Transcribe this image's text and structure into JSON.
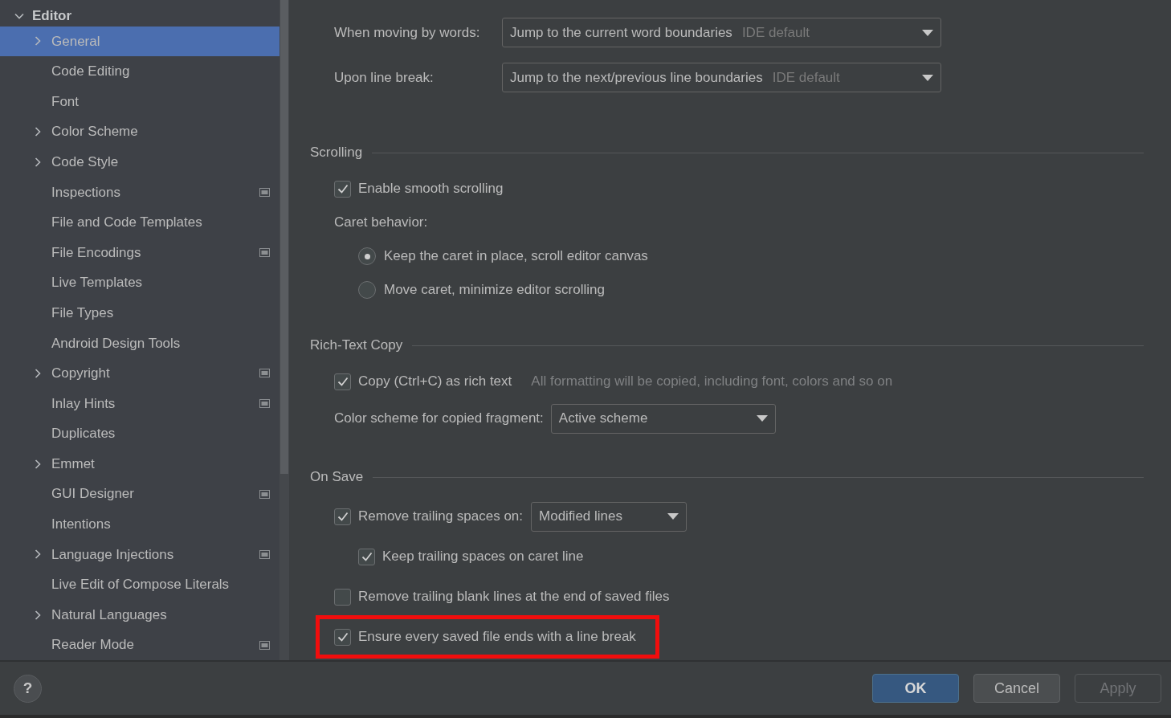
{
  "sidebar": {
    "header": {
      "label": "Editor",
      "expanded": true
    },
    "items": [
      {
        "label": "General",
        "expandable": true,
        "selected": true,
        "project_icon": false
      },
      {
        "label": "Code Editing",
        "expandable": false,
        "selected": false,
        "project_icon": false
      },
      {
        "label": "Font",
        "expandable": false,
        "selected": false,
        "project_icon": false
      },
      {
        "label": "Color Scheme",
        "expandable": true,
        "selected": false,
        "project_icon": false
      },
      {
        "label": "Code Style",
        "expandable": true,
        "selected": false,
        "project_icon": false
      },
      {
        "label": "Inspections",
        "expandable": false,
        "selected": false,
        "project_icon": true
      },
      {
        "label": "File and Code Templates",
        "expandable": false,
        "selected": false,
        "project_icon": false
      },
      {
        "label": "File Encodings",
        "expandable": false,
        "selected": false,
        "project_icon": true
      },
      {
        "label": "Live Templates",
        "expandable": false,
        "selected": false,
        "project_icon": false
      },
      {
        "label": "File Types",
        "expandable": false,
        "selected": false,
        "project_icon": false
      },
      {
        "label": "Android Design Tools",
        "expandable": false,
        "selected": false,
        "project_icon": false
      },
      {
        "label": "Copyright",
        "expandable": true,
        "selected": false,
        "project_icon": true
      },
      {
        "label": "Inlay Hints",
        "expandable": false,
        "selected": false,
        "project_icon": true
      },
      {
        "label": "Duplicates",
        "expandable": false,
        "selected": false,
        "project_icon": false
      },
      {
        "label": "Emmet",
        "expandable": true,
        "selected": false,
        "project_icon": false
      },
      {
        "label": "GUI Designer",
        "expandable": false,
        "selected": false,
        "project_icon": true
      },
      {
        "label": "Intentions",
        "expandable": false,
        "selected": false,
        "project_icon": false
      },
      {
        "label": "Language Injections",
        "expandable": true,
        "selected": false,
        "project_icon": true
      },
      {
        "label": "Live Edit of Compose Literals",
        "expandable": false,
        "selected": false,
        "project_icon": false
      },
      {
        "label": "Natural Languages",
        "expandable": true,
        "selected": false,
        "project_icon": false
      },
      {
        "label": "Reader Mode",
        "expandable": false,
        "selected": false,
        "project_icon": true
      }
    ]
  },
  "top_dropdowns": [
    {
      "label": "When moving by words:",
      "value": "Jump to the current word boundaries",
      "hint": "IDE default"
    },
    {
      "label": "Upon line break:",
      "value": "Jump to the next/previous line boundaries",
      "hint": "IDE default"
    }
  ],
  "sections": [
    {
      "title": "Scrolling",
      "items": [
        {
          "kind": "checkbox",
          "label": "Enable smooth scrolling",
          "checked": true
        },
        {
          "kind": "label",
          "label": "Caret behavior:"
        },
        {
          "kind": "radio",
          "label": "Keep the caret in place, scroll editor canvas",
          "selected": true
        },
        {
          "kind": "radio",
          "label": "Move caret, minimize editor scrolling",
          "selected": false
        }
      ]
    },
    {
      "title": "Rich-Text Copy",
      "items": [
        {
          "kind": "checkbox",
          "label": "Copy (Ctrl+C) as rich text",
          "checked": true,
          "note": "All formatting will be copied, including font, colors and so on"
        },
        {
          "kind": "dropdown",
          "label": "Color scheme for copied fragment:",
          "value": "Active scheme"
        }
      ]
    },
    {
      "title": "On Save",
      "items": [
        {
          "kind": "checkbox",
          "label": "Remove trailing spaces on:",
          "checked": true,
          "dropdown": "Modified lines",
          "children": [
            {
              "kind": "checkbox",
              "label": "Keep trailing spaces on caret line",
              "checked": true
            }
          ]
        },
        {
          "kind": "checkbox",
          "label": "Remove trailing blank lines at the end of saved files",
          "checked": false
        },
        {
          "kind": "checkbox",
          "label": "Ensure every saved file ends with a line break",
          "checked": true,
          "highlighted": true
        }
      ]
    }
  ],
  "help_button": "?",
  "buttons": [
    {
      "label": "OK",
      "kind": "default",
      "disabled": false
    },
    {
      "label": "Cancel",
      "kind": "normal",
      "disabled": false
    },
    {
      "label": "Apply",
      "kind": "normal",
      "disabled": true
    }
  ]
}
